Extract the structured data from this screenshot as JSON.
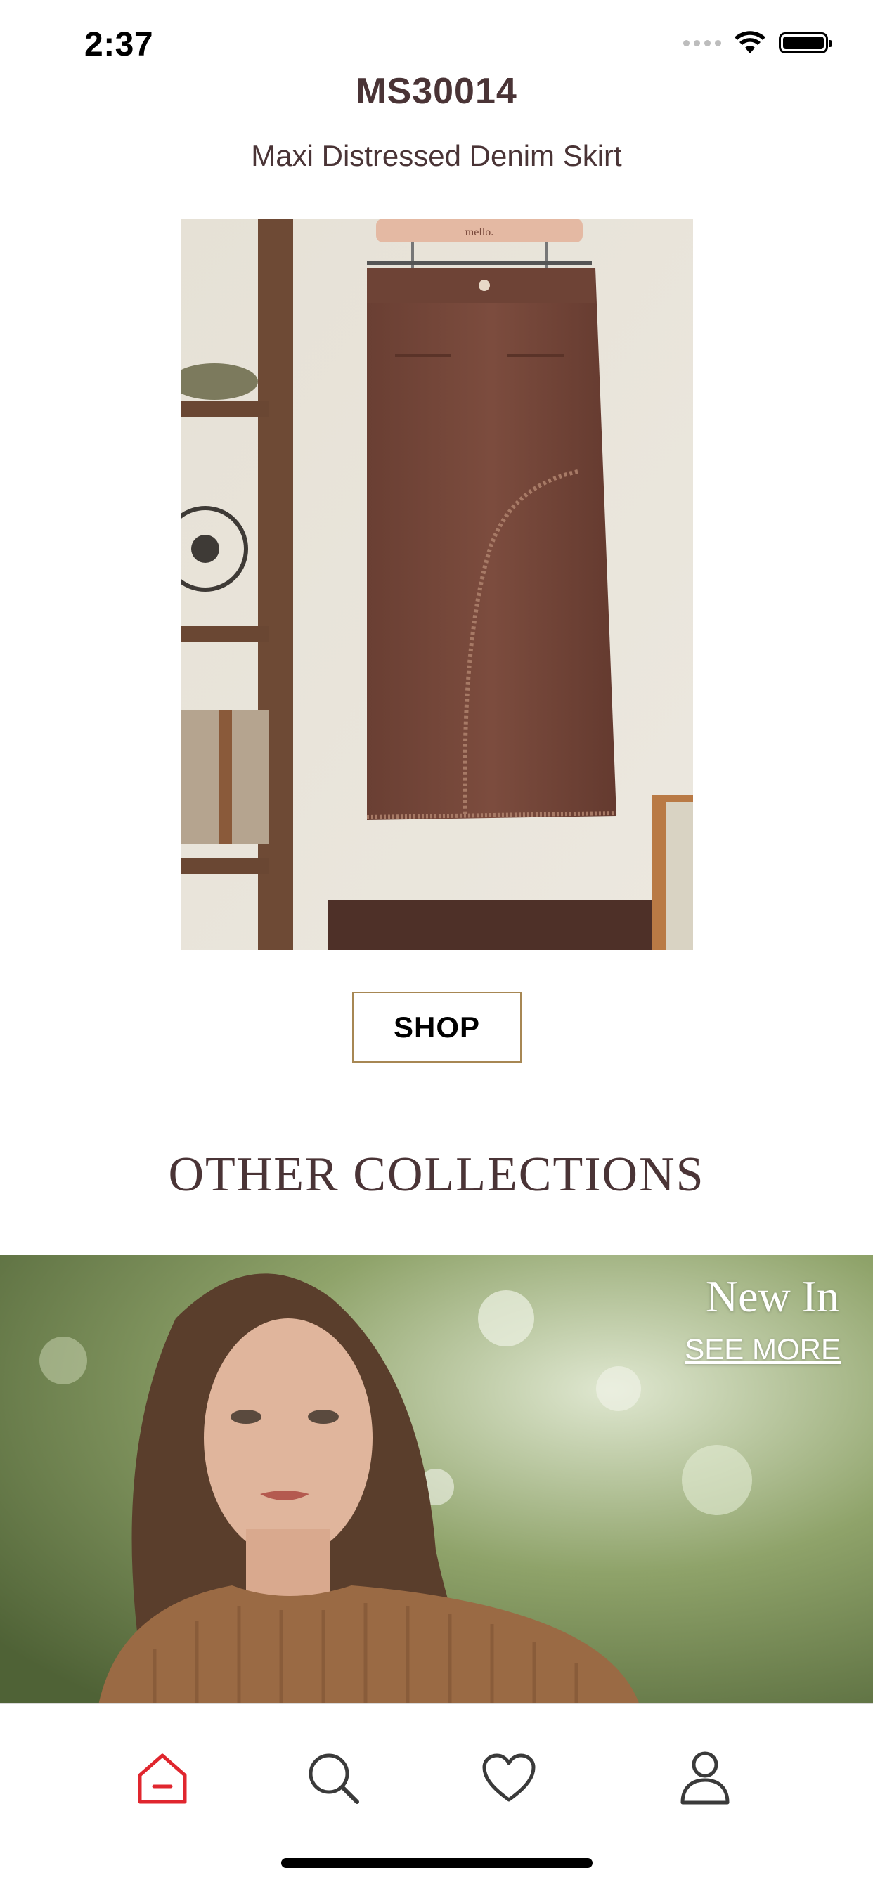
{
  "status_bar": {
    "time": "2:37"
  },
  "product": {
    "sku": "MS30014",
    "name": "Maxi Distressed Denim Skirt",
    "hanger_brand": "mello.",
    "shop_label": "SHOP"
  },
  "collections": {
    "section_title": "OTHER COLLECTIONS",
    "items": [
      {
        "title": "New In",
        "link_label": "SEE MORE"
      }
    ]
  },
  "tab_bar": {
    "tabs": [
      {
        "icon": "home-icon",
        "active": true
      },
      {
        "icon": "search-icon",
        "active": false
      },
      {
        "icon": "heart-icon",
        "active": false
      },
      {
        "icon": "profile-icon",
        "active": false
      }
    ],
    "active_color": "#e0262e",
    "inactive_color": "#3a3a3a"
  },
  "colors": {
    "text_primary": "#4a3436",
    "button_border": "#a78753"
  }
}
